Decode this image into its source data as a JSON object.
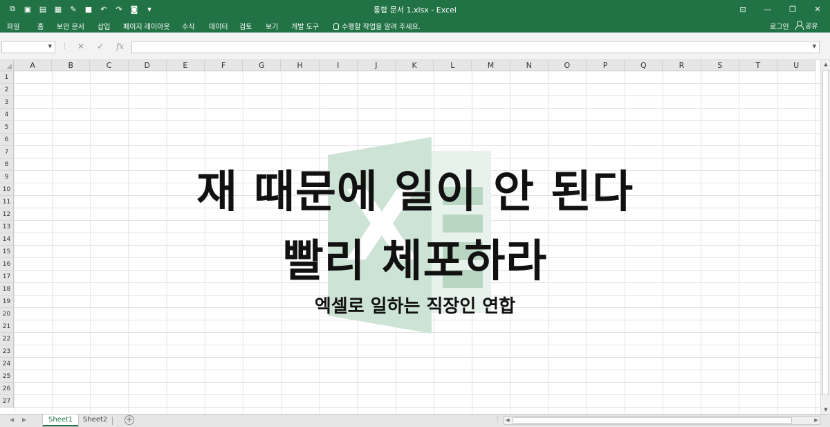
{
  "window": {
    "title": "통합 문서 1.xlsx - Excel",
    "controls": [
      "ribbon-display-icon",
      "minimize-icon",
      "restore-icon",
      "close-icon"
    ]
  },
  "qat": {
    "icons": [
      "autosave-icon",
      "save-copy-icon",
      "form-icon",
      "form2-icon",
      "draw-icon",
      "save-icon",
      "undo-icon",
      "redo-icon",
      "camera-icon",
      "customize-icon"
    ]
  },
  "ribbon": {
    "tabs": [
      "파일",
      "홈",
      "보안 문서",
      "삽입",
      "페이지 레이아웃",
      "수식",
      "데이터",
      "검토",
      "보기",
      "개발 도구"
    ],
    "tell_me": "수행할 작업을 알려 주세요.",
    "sign_in": "로그인",
    "share": "공유"
  },
  "formula_bar": {
    "name_box": "",
    "formula": "",
    "cancel_glyph": "✕",
    "enter_glyph": "✓",
    "fx_glyph": "fx"
  },
  "grid": {
    "columns": [
      "A",
      "B",
      "C",
      "D",
      "E",
      "F",
      "G",
      "H",
      "I",
      "J",
      "K",
      "L",
      "M",
      "N",
      "O",
      "P",
      "Q",
      "R",
      "S",
      "T",
      "U"
    ],
    "rows": [
      "1",
      "2",
      "3",
      "4",
      "5",
      "6",
      "7",
      "8",
      "9",
      "10",
      "11",
      "12",
      "13",
      "14",
      "15",
      "16",
      "17",
      "18",
      "19",
      "20",
      "21",
      "22",
      "23",
      "24",
      "25",
      "26",
      "27"
    ]
  },
  "overlay": {
    "line1": "재 때문에 일이 안 된다",
    "line2": "빨리 체포하라",
    "line3": "엑셀로 일하는 직장인 연합",
    "logo_letter": "X",
    "logo_color": "#217346"
  },
  "sheets": {
    "tabs": [
      "Sheet1",
      "Sheet2"
    ],
    "active": "Sheet1"
  },
  "colors": {
    "brand": "#217346",
    "header_bg": "#e6e6e6",
    "gridline": "#e2e2e2"
  }
}
